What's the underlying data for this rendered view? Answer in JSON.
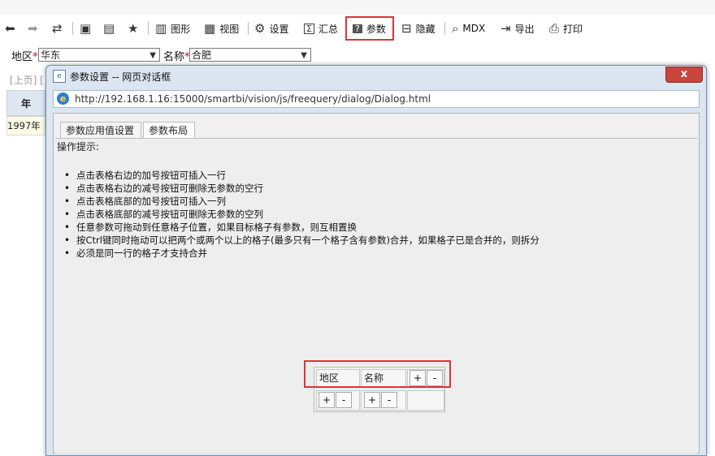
{
  "toolbar": {
    "chart": "图形",
    "view": "视图",
    "settings": "设置",
    "summary": "汇总",
    "params": "参数",
    "hide": "隐藏",
    "mdx": "MDX",
    "export": "导出",
    "print": "打印"
  },
  "params": {
    "region_label": "地区",
    "region_value": "华东",
    "name_label": "名称",
    "name_value": "合肥",
    "required_mark": "*"
  },
  "background": {
    "pager": "[上页] [",
    "year_header": "年",
    "year_value": "1997年"
  },
  "dialog": {
    "title": "参数设置 -- 网页对话框",
    "close": "x",
    "url": "http://192.168.1.16:15000/smartbi/vision/js/freequery/dialog/Dialog.html",
    "tabs": [
      "参数应用值设置",
      "参数布局"
    ],
    "hint_title": "操作提示:",
    "hints": [
      "点击表格右边的加号按钮可插入一行",
      "点击表格右边的减号按钮可删除无参数的空行",
      "点击表格底部的加号按钮可插入一列",
      "点击表格底部的减号按钮可删除无参数的空列",
      "任意参数可拖动到任意格子位置，如果目标格子有参数，则互相置换",
      "按Ctrl键同时拖动可以把两个或两个以上的格子(最多只有一个格子含有参数)合并，如果格子已是合并的，则拆分",
      "必须是同一行的格子才支持合并"
    ],
    "grid": {
      "cell1": "地区",
      "cell2": "名称",
      "plus": "+",
      "minus": "-"
    }
  },
  "colors": {
    "highlight": "#e0313a",
    "dialog_frame": "#dce6f1",
    "close_button": "#c9463d"
  }
}
